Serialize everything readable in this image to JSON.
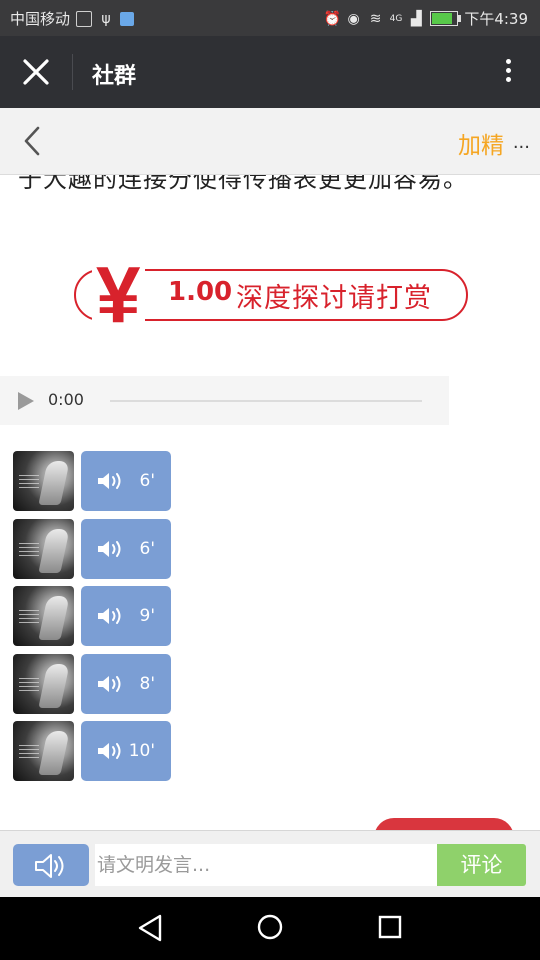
{
  "status_bar": {
    "carrier": "中国移动",
    "network": "4G",
    "time": "下午4:39",
    "battery_level": 0.85,
    "icons": [
      "notification-icon",
      "usb-icon",
      "app-icon",
      "alarm-icon",
      "eye-icon",
      "wifi-icon",
      "signal-icon",
      "battery-icon"
    ]
  },
  "title_bar": {
    "title": "社群",
    "icons": [
      "close-icon",
      "more-vertical-icon"
    ]
  },
  "sub_header": {
    "essence_label": "加精",
    "more_label": "...",
    "icons": [
      "chevron-left-icon"
    ]
  },
  "content": {
    "cut_text": "于大趣的连接分使得传播表更更加容易。",
    "reward": {
      "currency_symbol": "¥",
      "amount": "1.00",
      "label": "深度探讨请打赏",
      "color": "#d8222c"
    },
    "audio_player": {
      "time": "0:00",
      "progress": 0
    },
    "voice_messages": [
      {
        "duration": "6'"
      },
      {
        "duration": "6'"
      },
      {
        "duration": "9'"
      },
      {
        "duration": "8'"
      },
      {
        "duration": "10'"
      }
    ]
  },
  "input_bar": {
    "placeholder": "请文明发言...",
    "value": "",
    "submit_label": "评论",
    "icons": [
      "speaker-icon"
    ]
  },
  "colors": {
    "accent_orange": "#f5a623",
    "bubble_blue": "#7b9ed4",
    "comment_green": "#8fd16b",
    "title_bar_bg": "#2f3034"
  },
  "nav_bar": {
    "icons": [
      "nav-back-icon",
      "nav-home-icon",
      "nav-recent-icon"
    ]
  }
}
